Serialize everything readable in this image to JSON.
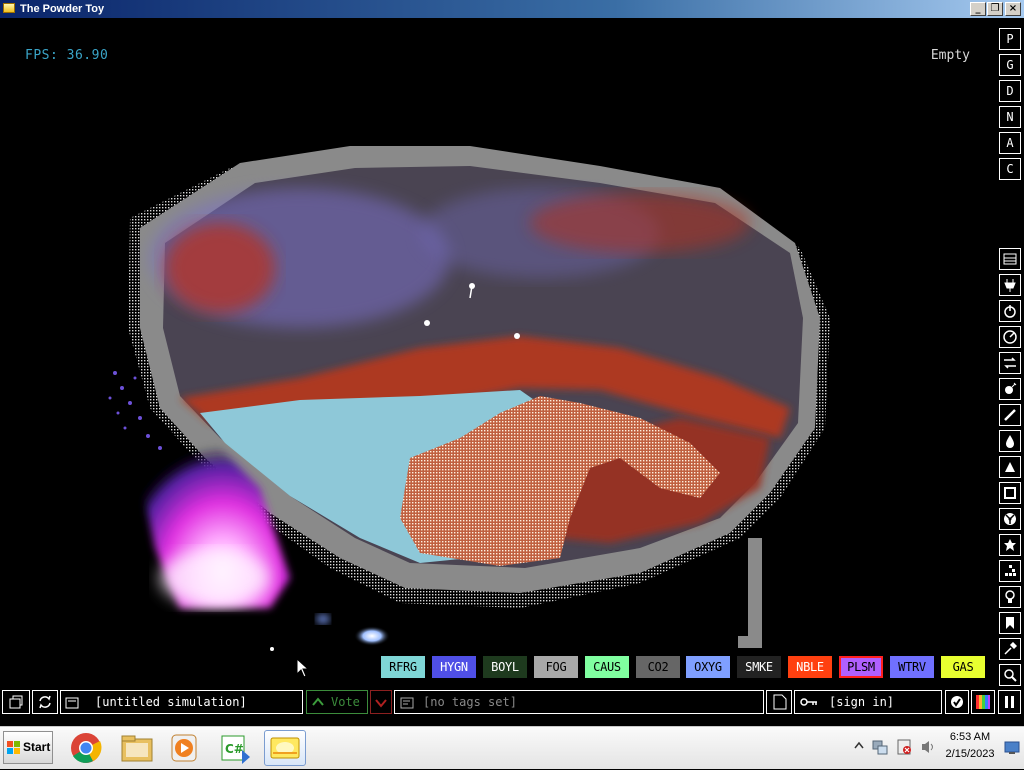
{
  "window": {
    "title": "The Powder Toy",
    "minimize": "_",
    "restore": "❐",
    "close": "×"
  },
  "hud": {
    "fps": "FPS: 36.90",
    "hover": "Empty"
  },
  "render_modes": [
    "P",
    "G",
    "D",
    "N",
    "A",
    "C"
  ],
  "categories": [
    "menu-icon",
    "electronics-icon",
    "power-icon",
    "pressure-icon",
    "conveyor-icon",
    "explosive-icon",
    "wall-icon",
    "liquid-icon",
    "powder-icon",
    "solid-icon",
    "radioactive-icon",
    "special-icon",
    "life-icon",
    "tools-icon",
    "favorites-icon",
    "search-icon"
  ],
  "elements": [
    {
      "label": "RFRG",
      "bg": "#7fd6d6",
      "fg": "#000000"
    },
    {
      "label": "HYGN",
      "bg": "#4f4fe6",
      "fg": "#ffffff"
    },
    {
      "label": "BOYL",
      "bg": "#1e3a1e",
      "fg": "#ffffff"
    },
    {
      "label": "FOG",
      "bg": "#a8a8a8",
      "fg": "#000000"
    },
    {
      "label": "CAUS",
      "bg": "#80ffa0",
      "fg": "#000000"
    },
    {
      "label": "CO2",
      "bg": "#666666",
      "fg": "#000000"
    },
    {
      "label": "OXYG",
      "bg": "#7f9fff",
      "fg": "#000000"
    },
    {
      "label": "SMKE",
      "bg": "#222222",
      "fg": "#ffffff"
    },
    {
      "label": "NBLE",
      "bg": "#ff4010",
      "fg": "#ffffff"
    },
    {
      "label": "PLSM",
      "bg": "#b060ff",
      "fg": "#000000",
      "selected": true
    },
    {
      "label": "WTRV",
      "bg": "#7070ff",
      "fg": "#000000"
    },
    {
      "label": "GAS",
      "bg": "#e8ff30",
      "fg": "#000000"
    }
  ],
  "bottom_bar": {
    "save_name": "[untitled simulation]",
    "vote": "Vote",
    "tags": "[no tags set]",
    "sign_in": "[sign in]"
  },
  "taskbar": {
    "start": "Start",
    "apps": [
      "chrome-icon",
      "file-explorer-icon",
      "media-player-icon",
      "visual-csharp-icon",
      "powder-toy-icon"
    ],
    "time": "6:53 AM",
    "date": "2/15/2023"
  }
}
